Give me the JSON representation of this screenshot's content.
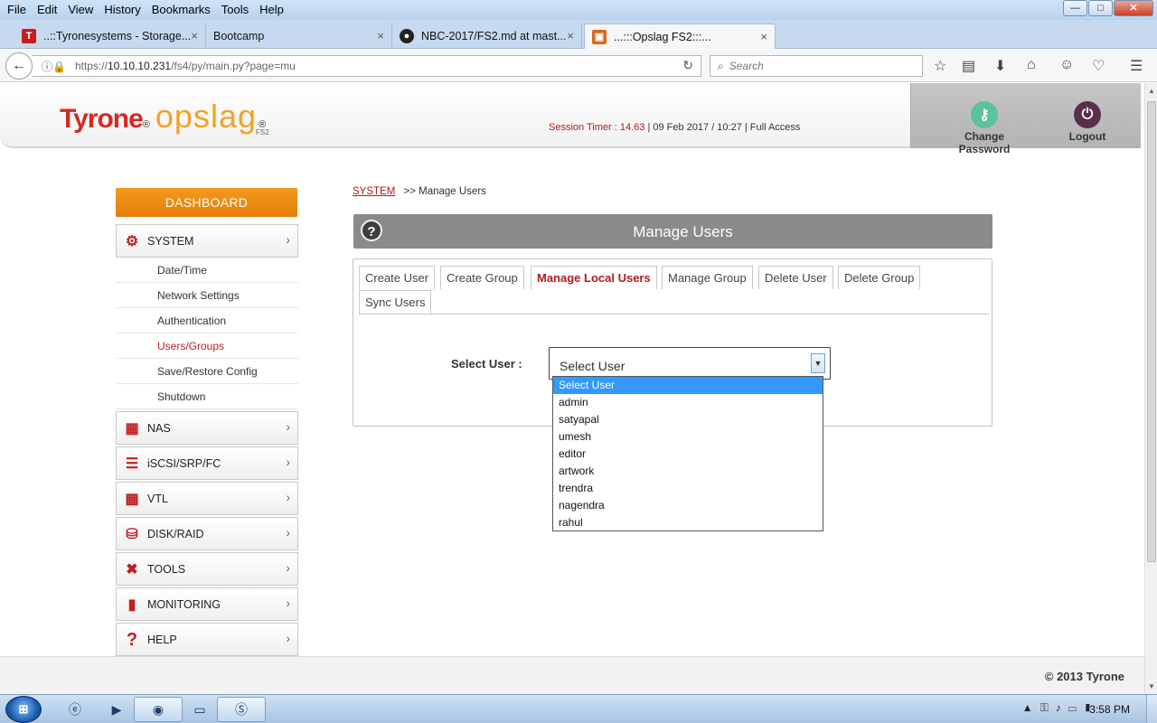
{
  "browser": {
    "menu": [
      {
        "label": "File"
      },
      {
        "label": "Edit"
      },
      {
        "label": "View"
      },
      {
        "label": "History"
      },
      {
        "label": "Bookmarks"
      },
      {
        "label": "Tools"
      },
      {
        "label": "Help"
      }
    ],
    "window_controls": {
      "minimize": "—",
      "maximize": "□",
      "close": "✕"
    },
    "tabs": [
      {
        "label": "..::Tyronesystems - Storage...",
        "close": "×"
      },
      {
        "label": "Bootcamp",
        "close": "×"
      },
      {
        "label": "NBC-2017/FS2.md at mast...",
        "close": "×"
      },
      {
        "label": "...:::Opslag FS2:::...",
        "close": "×",
        "active": true
      }
    ],
    "new_tab": "+",
    "url_scheme": "https://",
    "url_host": "10.10.10.231",
    "url_path": "/fs4/py/main.py?page=mu",
    "search_placeholder": "Search"
  },
  "header": {
    "brand": "Tyrone",
    "brand_reg": "®",
    "product": "opslag",
    "product_sub": "FS2",
    "product_reg": "®",
    "session_label": "Session Timer : ",
    "session_timer": "14.63",
    "session_rest": " | 09 Feb 2017 / 10:27 | Full Access",
    "change_password": "Change Password",
    "logout": "Logout"
  },
  "sidebar": {
    "dashboard": "DASHBOARD",
    "system": "SYSTEM",
    "system_items": [
      {
        "label": "Date/Time"
      },
      {
        "label": "Network Settings"
      },
      {
        "label": "Authentication"
      },
      {
        "label": "Users/Groups",
        "active": true
      },
      {
        "label": "Save/Restore Config"
      },
      {
        "label": "Shutdown"
      }
    ],
    "sections": [
      {
        "label": "NAS",
        "icon": "server-icon"
      },
      {
        "label": "iSCSI/SRP/FC",
        "icon": "storage-stack-icon"
      },
      {
        "label": "VTL",
        "icon": "tape-icon"
      },
      {
        "label": "DISK/RAID",
        "icon": "database-icon"
      },
      {
        "label": "TOOLS",
        "icon": "tools-icon"
      },
      {
        "label": "MONITORING",
        "icon": "bar-chart-icon"
      },
      {
        "label": "HELP",
        "icon": "question-icon"
      }
    ],
    "chevron": "›"
  },
  "main": {
    "breadcrumb_root": "SYSTEM",
    "breadcrumb_rest": ">> Manage Users",
    "panel_title": "Manage Users",
    "help": "?",
    "tabs": [
      {
        "label": "Create User"
      },
      {
        "label": "Create Group"
      },
      {
        "label": "Manage Local Users",
        "active": true
      },
      {
        "label": "Manage Group"
      },
      {
        "label": "Delete User"
      },
      {
        "label": "Delete Group"
      },
      {
        "label": "Sync Users"
      }
    ],
    "select_label": "Select User :",
    "select_value": "Select User",
    "dropdown_options": [
      {
        "label": "Select User",
        "selected": true
      },
      {
        "label": "admin"
      },
      {
        "label": "satyapal"
      },
      {
        "label": "umesh"
      },
      {
        "label": "editor"
      },
      {
        "label": "artwork"
      },
      {
        "label": "trendra"
      },
      {
        "label": "nagendra"
      },
      {
        "label": "rahul"
      }
    ]
  },
  "footer": {
    "copyright": "© 2013 Tyrone"
  },
  "taskbar": {
    "clock": "3:58 PM"
  },
  "colors": {
    "brand_red": "#d42a23",
    "brand_orange": "#f0a326",
    "dashboard_orange": "#e88a12",
    "panel_gray": "#8a8a8a",
    "active_red": "#b21a1a",
    "selection_blue": "#3399ff"
  }
}
